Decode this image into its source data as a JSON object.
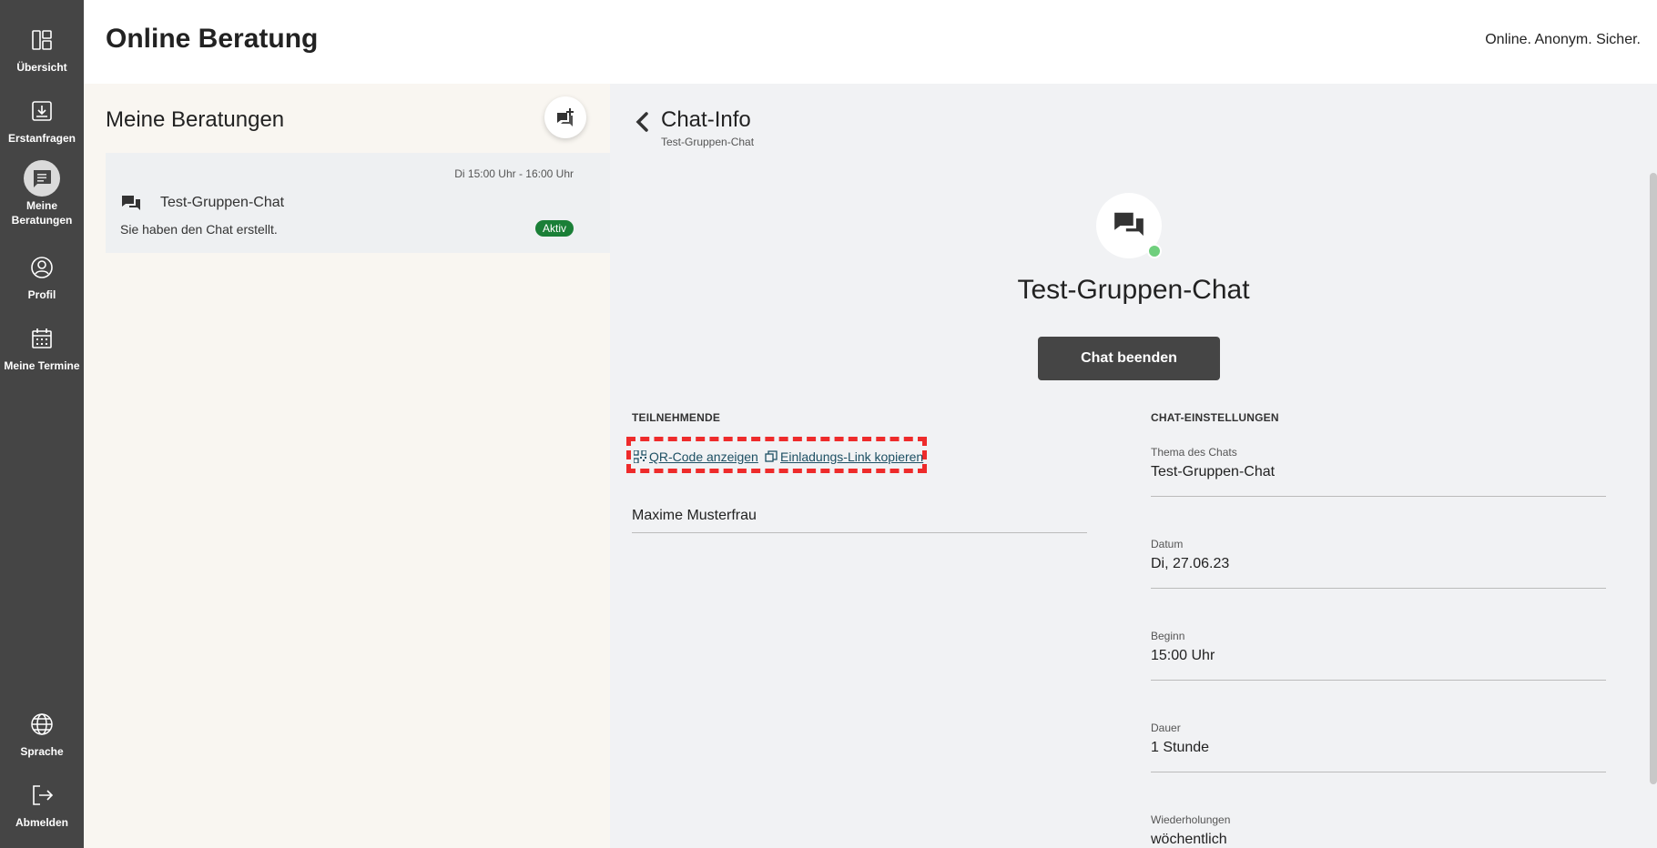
{
  "sidebar": {
    "items": [
      {
        "label": "Übersicht",
        "icon": "dashboard-icon"
      },
      {
        "label": "Erstanfragen",
        "icon": "inbox-icon"
      },
      {
        "label": "Meine Beratungen",
        "icon": "chat-list-icon",
        "active": true
      },
      {
        "label": "Profil",
        "icon": "user-icon"
      },
      {
        "label": "Meine Termine",
        "icon": "calendar-icon"
      }
    ],
    "bottom": [
      {
        "label": "Sprache",
        "icon": "globe-icon"
      },
      {
        "label": "Abmelden",
        "icon": "logout-icon"
      }
    ]
  },
  "header": {
    "title": "Online Beratung",
    "claim": "Online. Anonym. Sicher."
  },
  "sessions": {
    "title": "Meine Beratungen",
    "items": [
      {
        "time": "Di 15:00 Uhr - 16:00 Uhr",
        "name": "Test-Gruppen-Chat",
        "preview": "Sie haben den Chat erstellt.",
        "badge": "Aktiv"
      }
    ]
  },
  "chat_info": {
    "title": "Chat-Info",
    "subtitle": "Test-Gruppen-Chat",
    "name": "Test-Gruppen-Chat",
    "end_button": "Chat beenden",
    "participants": {
      "label": "TEILNEHMENDE",
      "qr_link": "QR-Code anzeigen",
      "copy_link": "Einladungs-Link kopieren",
      "list": [
        "Maxime Musterfrau"
      ]
    },
    "settings": {
      "label": "CHAT-EINSTELLUNGEN",
      "fields": [
        {
          "label": "Thema des Chats",
          "value": "Test-Gruppen-Chat"
        },
        {
          "label": "Datum",
          "value": "Di, 27.06.23"
        },
        {
          "label": "Beginn",
          "value": "15:00 Uhr"
        },
        {
          "label": "Dauer",
          "value": "1 Stunde"
        },
        {
          "label": "Wiederholungen",
          "value": "wöchentlich"
        }
      ]
    }
  },
  "colors": {
    "sidebar": "#454545",
    "badge": "#1a7f37",
    "highlight": "#ee2b2b",
    "online": "#6fcf7d"
  }
}
